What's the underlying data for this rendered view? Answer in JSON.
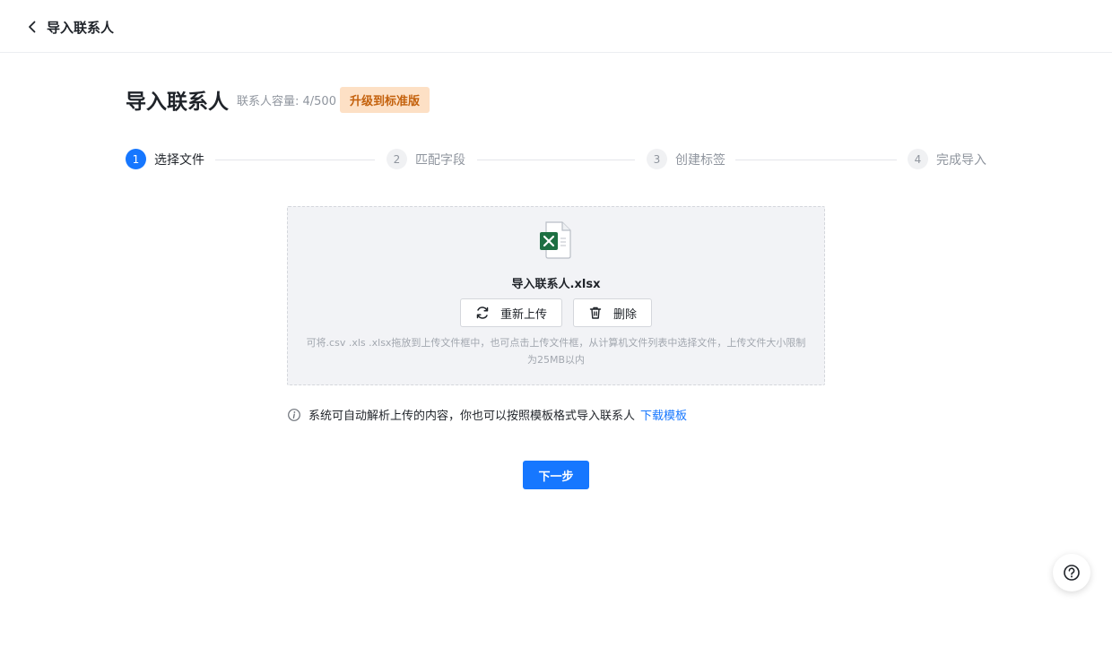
{
  "header": {
    "back_title": "导入联系人"
  },
  "page": {
    "title": "导入联系人",
    "capacity": "联系人容量: 4/500",
    "upgrade_label": "升级到标准版"
  },
  "steps": [
    {
      "num": "1",
      "label": "选择文件",
      "active": true
    },
    {
      "num": "2",
      "label": "匹配字段",
      "active": false
    },
    {
      "num": "3",
      "label": "创建标签",
      "active": false
    },
    {
      "num": "4",
      "label": "完成导入",
      "active": false
    }
  ],
  "upload": {
    "file_icon": "excel-file-icon",
    "file_name": "导入联系人.xlsx",
    "reupload_label": "重新上传",
    "delete_label": "删除",
    "hint": "可将.csv .xls .xlsx拖放到上传文件框中，也可点击上传文件框，从计算机文件列表中选择文件，上传文件大小限制为25MB以内"
  },
  "info": {
    "text": "系统可自动解析上传的内容，你也可以按照模板格式导入联系人",
    "link_label": "下载模板"
  },
  "next_label": "下一步",
  "colors": {
    "primary": "#1677ff",
    "upgrade_bg": "#fde0c5",
    "upgrade_text": "#c4610c"
  }
}
